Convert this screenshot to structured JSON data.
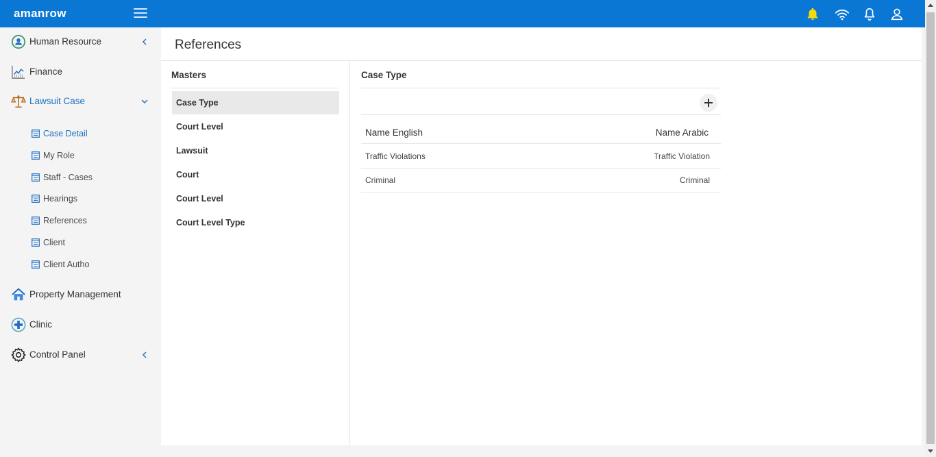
{
  "app": {
    "brand": "amanrow"
  },
  "sidebar": {
    "groups": [
      {
        "label": "Human Resource"
      },
      {
        "label": "Finance"
      },
      {
        "label": "Lawsuit Case"
      },
      {
        "label": "Property Management"
      },
      {
        "label": "Clinic"
      },
      {
        "label": "Control Panel"
      }
    ],
    "lawsuit_items": [
      {
        "label": "Case Detail"
      },
      {
        "label": "My Role"
      },
      {
        "label": "Staff - Cases"
      },
      {
        "label": "Hearings"
      },
      {
        "label": "References"
      },
      {
        "label": "Client"
      },
      {
        "label": "Client Autho"
      }
    ]
  },
  "page": {
    "title": "References"
  },
  "masters": {
    "title": "Masters",
    "items": [
      {
        "label": "Case Type"
      },
      {
        "label": "Court Level"
      },
      {
        "label": "Lawsuit"
      },
      {
        "label": "Court"
      },
      {
        "label": "Court Level"
      },
      {
        "label": "Court Level Type"
      }
    ]
  },
  "detail": {
    "title": "Case Type",
    "columns": {
      "name_english": "Name English",
      "name_arabic": "Name Arabic"
    },
    "rows": [
      {
        "name_english": "Traffic Violations",
        "name_arabic": "Traffic Violation"
      },
      {
        "name_english": "Criminal",
        "name_arabic": "Criminal"
      }
    ]
  },
  "colors": {
    "topbar": "#0b77d4",
    "accent": "#1a6fc2",
    "bell": "#f5d90a"
  }
}
